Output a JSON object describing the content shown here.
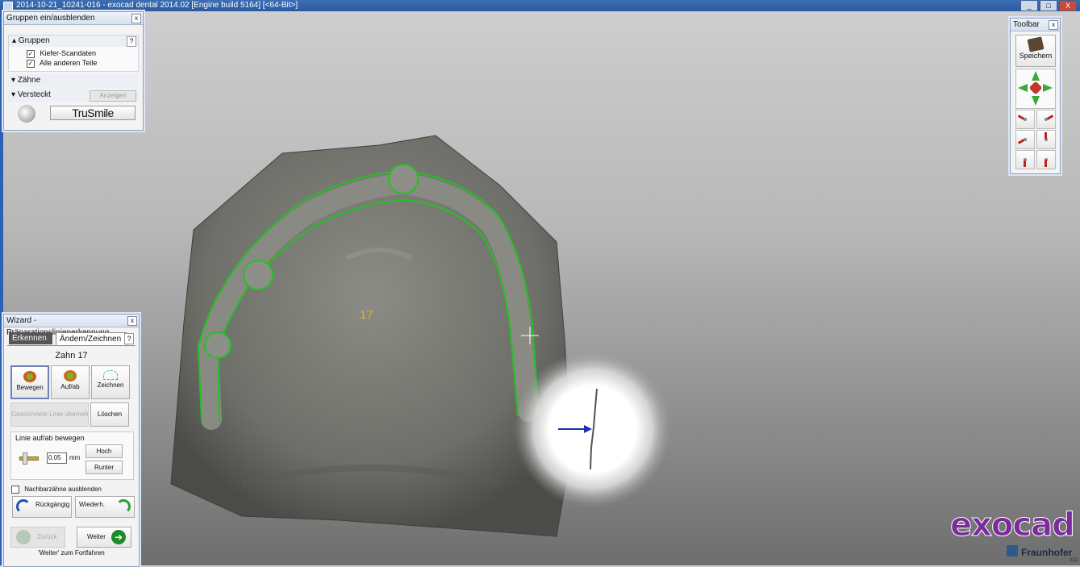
{
  "window": {
    "title": "2014-10-21_10241-016 - exocad dental 2014.02 [Engine build 5164] [<64-Bit>]",
    "buttons": [
      "_",
      "□",
      "X"
    ]
  },
  "viewport": {
    "tooth_label": "17"
  },
  "groups_panel": {
    "title": "Gruppen ein/ausblenden",
    "close": "x",
    "sections": {
      "gruppen": {
        "label": "Gruppen",
        "help": "?",
        "items": [
          {
            "label": "Kiefer-Scandaten",
            "checked": true
          },
          {
            "label": "Alle anderen Teile",
            "checked": true
          }
        ]
      },
      "zaehne": {
        "label": "Zähne"
      },
      "versteckt": {
        "label": "Versteckt",
        "button": "Anzeigen"
      }
    },
    "trusmile_button": "TruSmile"
  },
  "toolbar_panel": {
    "title": "Toolbar",
    "close": "x",
    "save_label": "Speichern"
  },
  "wizard_panel": {
    "title": "Wizard - Präparationslinienerkennung",
    "close": "x",
    "tabs": [
      "Erkennen",
      "Ändern/Zeichnen"
    ],
    "help": "?",
    "zahn_title": "Zahn 17",
    "tools": [
      {
        "label": "Bewegen",
        "active": true
      },
      {
        "label": "Auf/ab",
        "active": false
      },
      {
        "label": "Zeichnen",
        "active": false
      }
    ],
    "apply_drawn_label": "Gezeichnete Linie übernehmen",
    "delete_label": "Löschen",
    "line_box": {
      "title": "Linie auf/ab bewegen",
      "value": "0,05",
      "unit": "mm",
      "up": "Hoch",
      "down": "Runter"
    },
    "hide_neighbors": {
      "label": "Nachbarzähne ausblenden",
      "checked": false
    },
    "undo_label": "Rückgängig",
    "redo_label": "Wiederh.",
    "back_label": "Zurück",
    "next_label": "Weiter",
    "hint": "'Weiter' zum Fortfahren"
  },
  "logo": {
    "brand": "exocad",
    "partner": "Fraunhofer",
    "sub": "IGD"
  }
}
